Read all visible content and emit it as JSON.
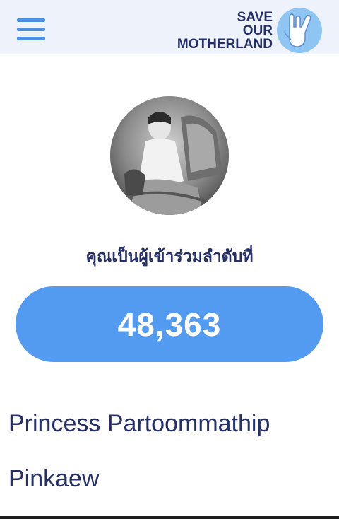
{
  "header": {
    "menu_icon": "hamburger-menu-icon",
    "logo": {
      "lines": [
        "SAVE",
        "OUR",
        "MOTHERLAND"
      ],
      "icon": "hand-sign-icon"
    }
  },
  "profile": {
    "avatar_icon": "portrait-photo",
    "rank_label": "คุณเป็นผู้เข้าร่วมลำดับที่",
    "rank_value": "48,363",
    "name_lines": [
      "Princess Partoommathip",
      "Pinkaew"
    ]
  },
  "colors": {
    "accent_blue": "#539bf0",
    "text_navy": "#25306a",
    "header_bg": "#eef3fb"
  }
}
